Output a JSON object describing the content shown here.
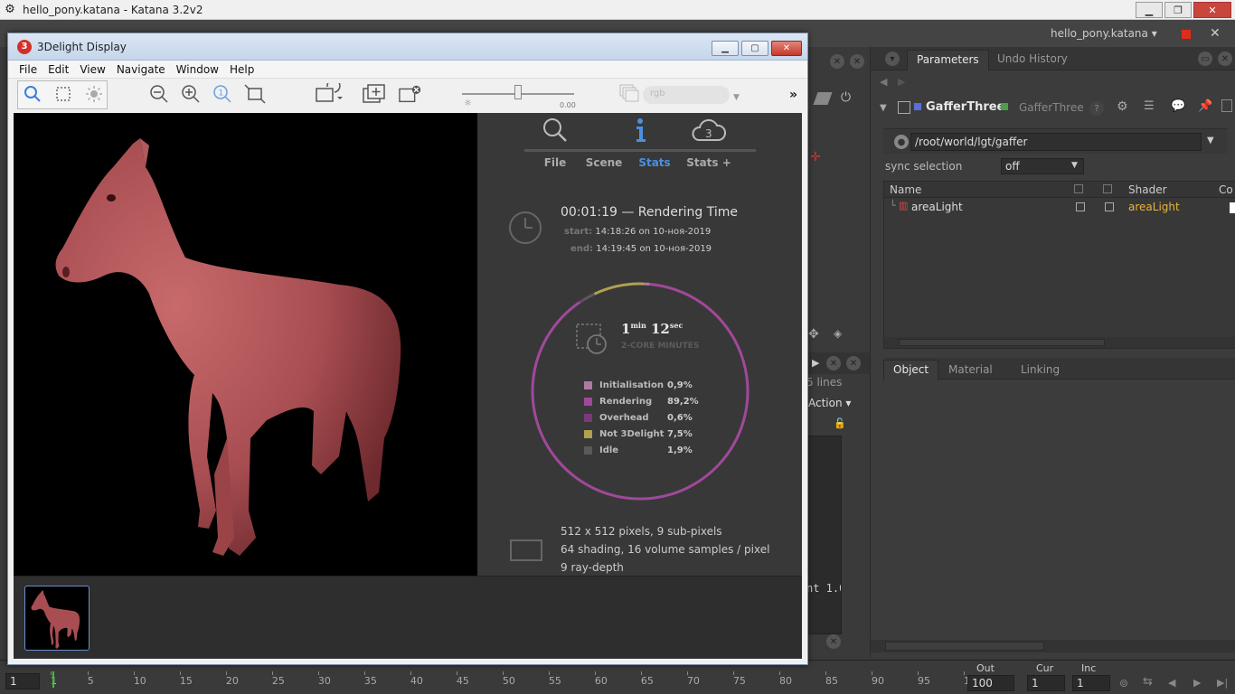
{
  "katana": {
    "window_title": "hello_pony.katana - Katana 3.2v2",
    "project_label": "hello_pony.katana",
    "panel_tabs": {
      "parameters": "Parameters",
      "undo_history": "Undo History"
    },
    "node": {
      "name": "GafferThree",
      "type": "GafferThree"
    },
    "path": "/root/world/lgt/gaffer",
    "sync_selection": {
      "label": "sync selection",
      "value": "off"
    },
    "table": {
      "headers": {
        "name": "Name",
        "shader": "Shader",
        "co": "Co"
      },
      "rows": [
        {
          "name": "areaLight",
          "shader": "areaLight"
        }
      ]
    },
    "bottom_tabs": {
      "object": "Object",
      "material": "Material",
      "linking": "Linking"
    },
    "center": {
      "lines": "5 lines",
      "action": "Action",
      "code": "nt 1.0"
    },
    "timeline": {
      "ticks": [
        "1",
        "5",
        "10",
        "15",
        "20",
        "25",
        "30",
        "35",
        "40",
        "45",
        "50",
        "55",
        "60",
        "65",
        "70",
        "75",
        "80",
        "85",
        "90",
        "95",
        "100"
      ],
      "start": "1",
      "out_label": "Out",
      "out_value": "100",
      "cur_label": "Cur",
      "cur_value": "1",
      "inc_label": "Inc",
      "inc_value": "1"
    }
  },
  "dl": {
    "title": "3Delight Display",
    "menu": [
      "File",
      "Edit",
      "View",
      "Navigate",
      "Window",
      "Help"
    ],
    "exposure_value": "0.00",
    "channel_placeholder": "rgb",
    "stats_tabs": [
      "File",
      "Scene",
      "Stats",
      "Stats +"
    ],
    "rendering_time": "00:01:19 — Rendering Time",
    "start_label": "start:",
    "start_value": "14:18:26 on 10-ноя-2019",
    "end_label": "end:",
    "end_value": "14:19:45 on 10-ноя-2019",
    "core_min": "1",
    "core_min_unit": "min",
    "core_sec": "12",
    "core_sec_unit": "sec",
    "core_label": "2-CORE MINUTES",
    "legend": [
      {
        "name": "Initialisation",
        "pct": "0,9%",
        "color": "#b07aa0",
        "value": 0.9
      },
      {
        "name": "Rendering",
        "pct": "89,2%",
        "color": "#a0489c",
        "value": 89.2
      },
      {
        "name": "Overhead",
        "pct": "0,6%",
        "color": "#7a3a78",
        "value": 0.6
      },
      {
        "name": "Not 3Delight",
        "pct": "7,5%",
        "color": "#b0a050",
        "value": 7.5
      },
      {
        "name": "Idle",
        "pct": "1,9%",
        "color": "#5a5a5a",
        "value": 1.9
      }
    ],
    "bottom": [
      "512 x 512 pixels, 9 sub-pixels",
      "64 shading, 16 volume samples / pixel",
      "9 ray-depth"
    ]
  }
}
